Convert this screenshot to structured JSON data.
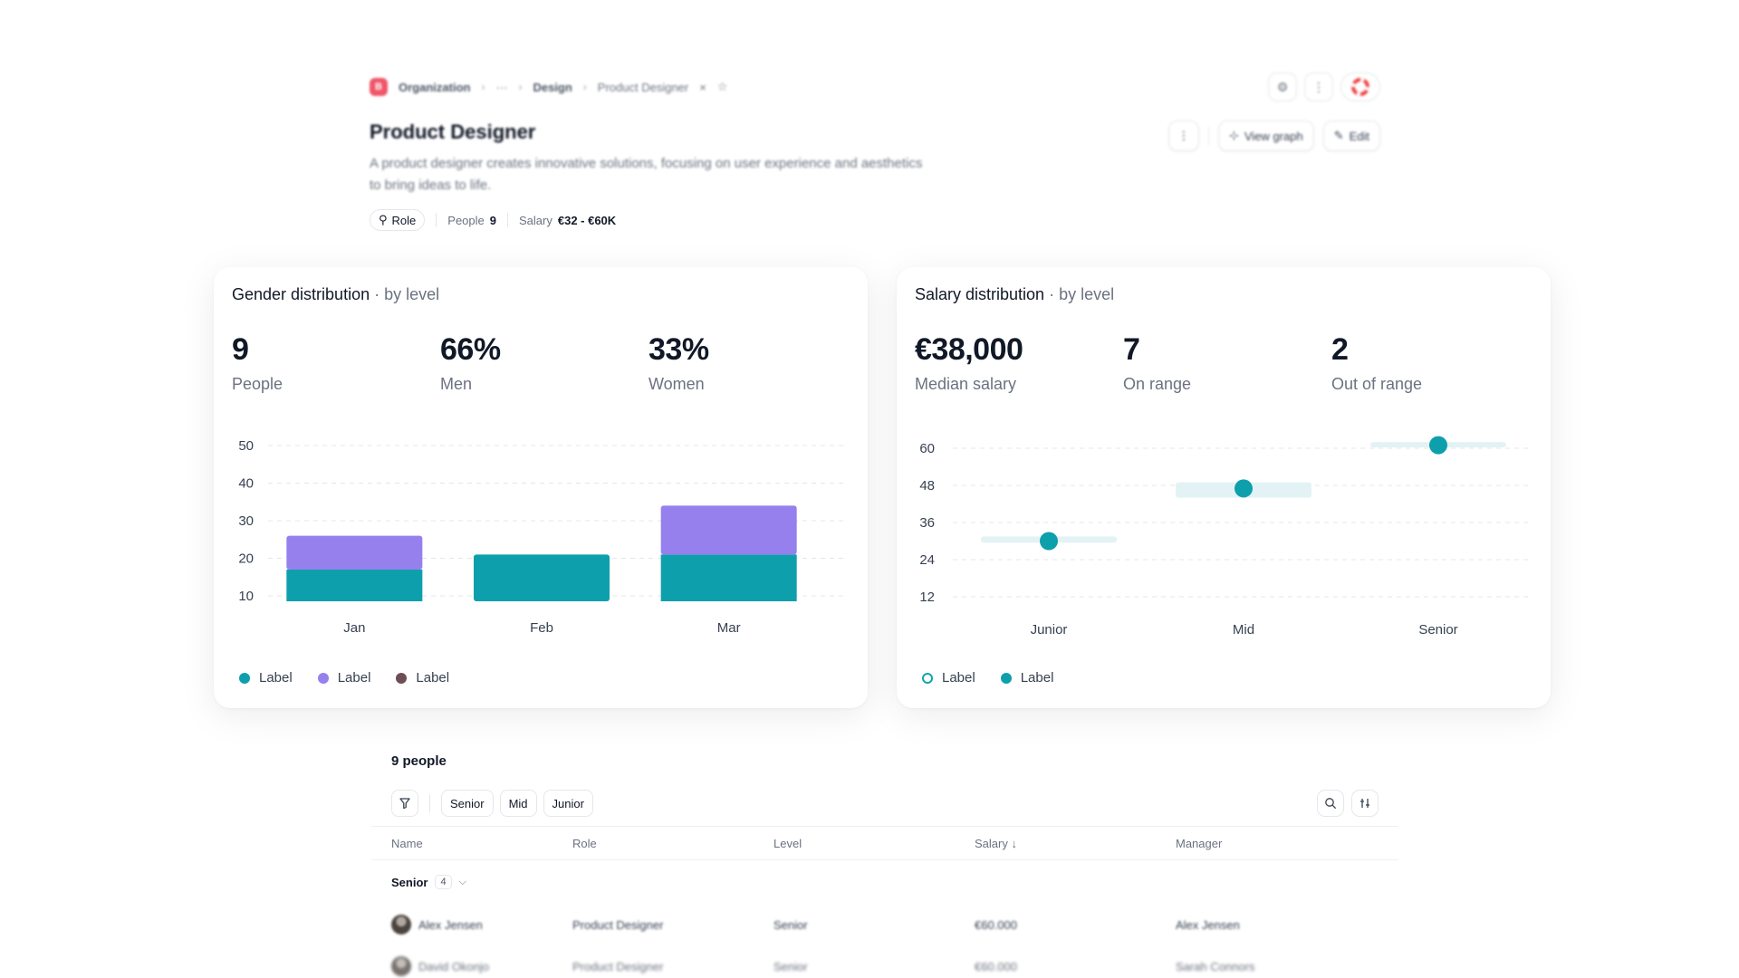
{
  "breadcrumb": {
    "logo": "B",
    "org": "Organization",
    "ellipsis": "···",
    "section": "Design",
    "current": "Product Designer",
    "close": "×",
    "star": "☆"
  },
  "top_icons": {
    "settings": "⚙",
    "more": "⋮",
    "help": "◉"
  },
  "header": {
    "title": "Product Designer",
    "description": "A product designer creates innovative solutions, focusing on user experience and aesthetics to bring ideas to life.",
    "role_chip": "Role",
    "people_label": "People",
    "people_value": "9",
    "salary_label": "Salary",
    "salary_value": "€32 - €60K",
    "more_button": "⋮",
    "view_graph": "View graph",
    "edit": "Edit"
  },
  "gender_card": {
    "title": "Gender distribution",
    "subtitle": "· by level",
    "stats": [
      {
        "value": "9",
        "label": "People"
      },
      {
        "value": "66%",
        "label": "Men"
      },
      {
        "value": "33%",
        "label": "Women"
      }
    ],
    "legend": [
      {
        "label": "Label",
        "color": "#0e9fad"
      },
      {
        "label": "Label",
        "color": "#9580ee"
      },
      {
        "label": "Label",
        "color": "#6e4e55"
      }
    ]
  },
  "salary_card": {
    "title": "Salary distribution",
    "subtitle": "· by level",
    "stats": [
      {
        "value": "€38,000",
        "label": "Median salary"
      },
      {
        "value": "7",
        "label": "On range"
      },
      {
        "value": "2",
        "label": "Out of range"
      }
    ],
    "legend": [
      {
        "label": "Label",
        "style": "ring"
      },
      {
        "label": "Label",
        "style": "filled"
      }
    ]
  },
  "chart_data": [
    {
      "type": "bar",
      "stacked": true,
      "categories": [
        "Jan",
        "Feb",
        "Mar"
      ],
      "series": [
        {
          "name": "Label",
          "color": "#0e9fad",
          "values": [
            17,
            21,
            21
          ]
        },
        {
          "name": "Label",
          "color": "#9580ee",
          "values": [
            9,
            0,
            13
          ]
        }
      ],
      "yticks": [
        10,
        20,
        30,
        40,
        50
      ],
      "ylim": [
        0,
        50
      ],
      "grid": true
    },
    {
      "type": "scatter",
      "categories": [
        "Junior",
        "Mid",
        "Senior"
      ],
      "points": [
        30,
        47,
        61
      ],
      "ranges": [
        [
          29.5,
          31.5
        ],
        [
          44,
          49
        ],
        [
          60.5,
          62
        ]
      ],
      "yticks": [
        12,
        24,
        36,
        48,
        60
      ],
      "ylim": [
        12,
        62
      ],
      "grid": true,
      "colors": {
        "point": "#0e9fad",
        "range": "#e3f3f5"
      }
    }
  ],
  "people": {
    "title": "9 people",
    "filters": [
      "Senior",
      "Mid",
      "Junior"
    ],
    "columns": [
      "Name",
      "Role",
      "Level",
      "Salary ↓",
      "Manager"
    ],
    "group": {
      "label": "Senior",
      "count": "4"
    },
    "rows": [
      {
        "name": "Alex Jensen",
        "role": "Product Designer",
        "level": "Senior",
        "salary": "€60.000",
        "manager": "Alex Jensen"
      },
      {
        "name": "David Okonjo",
        "role": "Product Designer",
        "level": "Senior",
        "salary": "€60.000",
        "manager": "Sarah Connors"
      }
    ]
  }
}
